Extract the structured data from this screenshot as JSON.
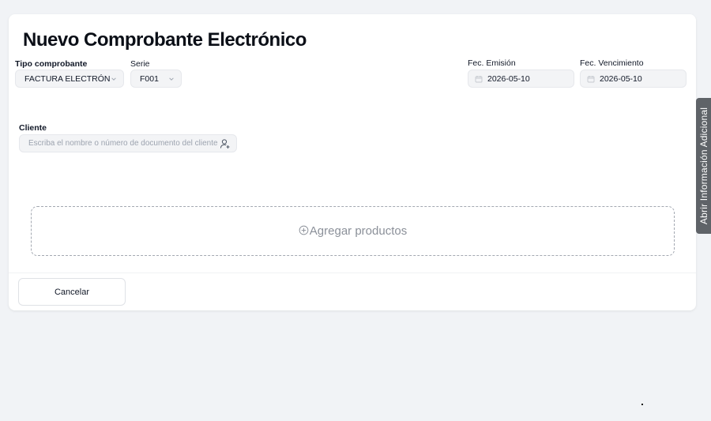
{
  "page": {
    "title": "Nuevo Comprobante Electrónico"
  },
  "form": {
    "tipo_label": "Tipo comprobante",
    "tipo_value": "FACTURA ELECTRÓNICA",
    "serie_label": "Serie",
    "serie_value": "F001",
    "emision_label": "Fec. Emisión",
    "emision_value": "2026-05-10",
    "vencimiento_label": "Fec. Vencimiento",
    "vencimiento_value": "2026-05-10",
    "cliente_label": "Cliente",
    "cliente_placeholder": "Escriba el nombre o número de documento del cliente"
  },
  "products": {
    "add_label": "Agregar productos"
  },
  "actions": {
    "cancel_label": "Cancelar"
  },
  "side_panel": {
    "label": "Abrir Información Adicional"
  },
  "icons": {
    "select_chevron": "chevron-down-icon",
    "date": "calendar-icon",
    "client": "add-user-icon",
    "add": "plus-circle-icon"
  },
  "colors": {
    "background": "#f1f3f6",
    "card": "#ffffff",
    "input_bg": "#f3f4f6",
    "side_tab": "#5f6368",
    "muted_text": "#8b9099"
  }
}
